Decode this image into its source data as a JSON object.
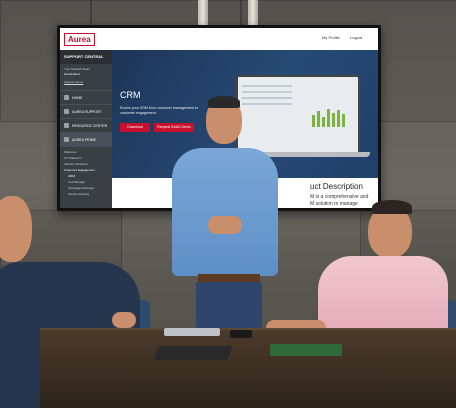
{
  "screen": {
    "logo": "Aurea",
    "top_links": [
      "My Profile",
      "Logout"
    ],
    "sidebar": {
      "header": "SUPPORT CENTRAL",
      "intro_lines": [
        "Your Network Team",
        "Not Entitled"
      ],
      "link": "Support Home",
      "items": [
        "HOME",
        "AUREA SUPPORT",
        "RESOURCE CENTER",
        "AUREA PRIME"
      ],
      "sub_items": [
        "Welcome",
        "CX Platforms",
        "Industry Solutions",
        "Customer Engagement",
        "CRM",
        "List Manager",
        "Campaign Manager",
        "Social Listening"
      ]
    },
    "hero": {
      "title": "CRM",
      "description": "Evolve your CRM from customer management to customer engagement.",
      "buttons": [
        "Download",
        "Request SAAS Demo"
      ]
    },
    "section": {
      "title": "uct Description",
      "line1": "M is a comprehensive and",
      "line2": "M solution to manage"
    }
  },
  "colors": {
    "accent_red": "#c8102e",
    "hero_blue": "#1d3557",
    "sidebar_dark": "#3a3f44"
  }
}
